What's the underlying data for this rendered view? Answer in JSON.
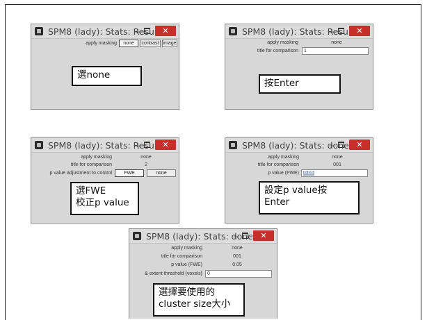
{
  "windows": [
    {
      "title": "SPM8 (lady): Stats: Results",
      "rows": [
        {
          "label": "apply masking",
          "buttons": [
            "none",
            "contrast",
            "image"
          ],
          "selected": 0
        }
      ],
      "callout": [
        "選none"
      ]
    },
    {
      "title": "SPM8 (lady): Stats: Results",
      "rows": [
        {
          "label": "apply masking",
          "value": "none"
        },
        {
          "label": "title for comparison",
          "input": "1"
        }
      ],
      "callout": [
        "按Enter"
      ]
    },
    {
      "title": "SPM8 (lady): Stats: Results",
      "rows": [
        {
          "label": "apply masking",
          "value": "none"
        },
        {
          "label": "title for comparison",
          "value": "2"
        },
        {
          "label": "p value adjustment to control",
          "buttons": [
            "FWE",
            "none"
          ],
          "selected": 0
        }
      ],
      "callout": [
        "選FWE",
        "校正p value"
      ]
    },
    {
      "title": "SPM8 (lady): Stats: done",
      "rows": [
        {
          "label": "apply masking",
          "value": "none"
        },
        {
          "label": "title for comparison",
          "value": "001"
        },
        {
          "label": "p value (FWE)",
          "input": "0.05"
        }
      ],
      "callout": [
        "設定p value按",
        "Enter"
      ]
    },
    {
      "title": "SPM8 (lady): Stats: done",
      "rows": [
        {
          "label": "apply masking",
          "value": "none"
        },
        {
          "label": "title for comparison",
          "value": "001"
        },
        {
          "label": "p value (FWE)",
          "value": "0.05"
        },
        {
          "label": "& extent threshold {voxels}",
          "input": "0"
        }
      ],
      "callout": [
        "選擇要使用的",
        "cluster size大小"
      ]
    }
  ],
  "icons": {
    "app": "spm-app-icon",
    "minimize": "minimize-icon",
    "maximize": "maximize-icon",
    "close": "close-icon"
  },
  "colors": {
    "close_button": "#c7302a",
    "window_bg": "#d7d7d7",
    "input_highlight": "#9db0c8"
  }
}
